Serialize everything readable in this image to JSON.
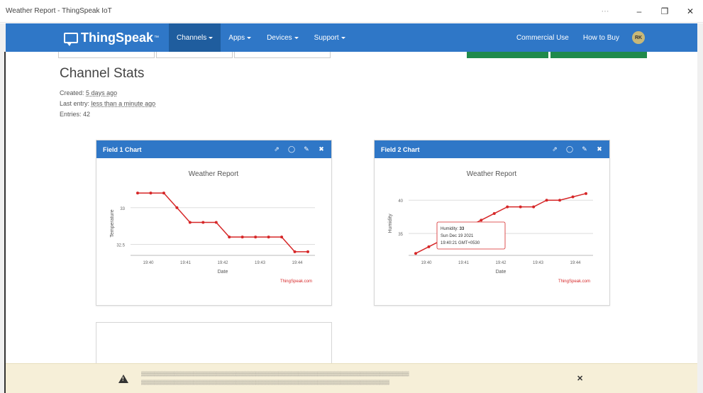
{
  "window": {
    "title": "Weather Report - ThingSpeak IoT",
    "controls": {
      "more": "···",
      "minimize": "–",
      "restore": "❐",
      "close": "✕"
    }
  },
  "navbar": {
    "brand": "ThingSpeak",
    "brand_tm": "™",
    "menu": [
      {
        "label": "Channels",
        "active": true
      },
      {
        "label": "Apps",
        "active": false
      },
      {
        "label": "Devices",
        "active": false
      },
      {
        "label": "Support",
        "active": false
      }
    ],
    "right": [
      {
        "label": "Commercial Use"
      },
      {
        "label": "How to Buy"
      }
    ],
    "avatar_initials": "RK"
  },
  "stats": {
    "title": "Channel Stats",
    "created_label": "Created:",
    "created_value": "5 days ago",
    "last_entry_label": "Last entry:",
    "last_entry_value": "less than a minute ago",
    "entries_label": "Entries:",
    "entries_value": "42"
  },
  "field1": {
    "header": "Field 1 Chart",
    "icons": [
      "external-link-icon",
      "comment-icon",
      "pencil-icon",
      "close-icon"
    ]
  },
  "field2": {
    "header": "Field 2 Chart",
    "icons": [
      "external-link-icon",
      "comment-icon",
      "pencil-icon",
      "close-icon"
    ],
    "tooltip": {
      "line1_label": "Humidity:",
      "line1_value": "33",
      "line2": "Sun Dec 19 2021",
      "line3": "19:40:21 GMT+0530"
    }
  },
  "chart_data": [
    {
      "type": "line",
      "title": "Weather Report",
      "xlabel": "Date",
      "ylabel": "Temperature",
      "credit": "ThingSpeak.com",
      "x_ticks": [
        "19:40",
        "19:41",
        "19:42",
        "19:43",
        "19:44"
      ],
      "y_ticks": [
        {
          "label": "33",
          "value": 33
        },
        {
          "label": "32.5",
          "value": 32.5
        }
      ],
      "ylim": [
        32.35,
        33.22
      ],
      "color": "#d62728",
      "grid": true,
      "values": [
        33.2,
        33.2,
        33.2,
        33.0,
        32.8,
        32.8,
        32.8,
        32.6,
        32.6,
        32.6,
        32.6,
        32.6,
        32.4,
        32.4
      ]
    },
    {
      "type": "line",
      "title": "Weather Report",
      "xlabel": "Date",
      "ylabel": "Humidity",
      "credit": "ThingSpeak.com",
      "x_ticks": [
        "19:40",
        "19:41",
        "19:42",
        "19:43",
        "19:44"
      ],
      "y_ticks": [
        {
          "label": "40",
          "value": 40
        },
        {
          "label": "35",
          "value": 35
        }
      ],
      "ylim": [
        31.7,
        41.3
      ],
      "color": "#d62728",
      "grid": true,
      "values": [
        32,
        33,
        34,
        35,
        36,
        37,
        38,
        39,
        39,
        39,
        40,
        40,
        40.5,
        41
      ]
    }
  ]
}
